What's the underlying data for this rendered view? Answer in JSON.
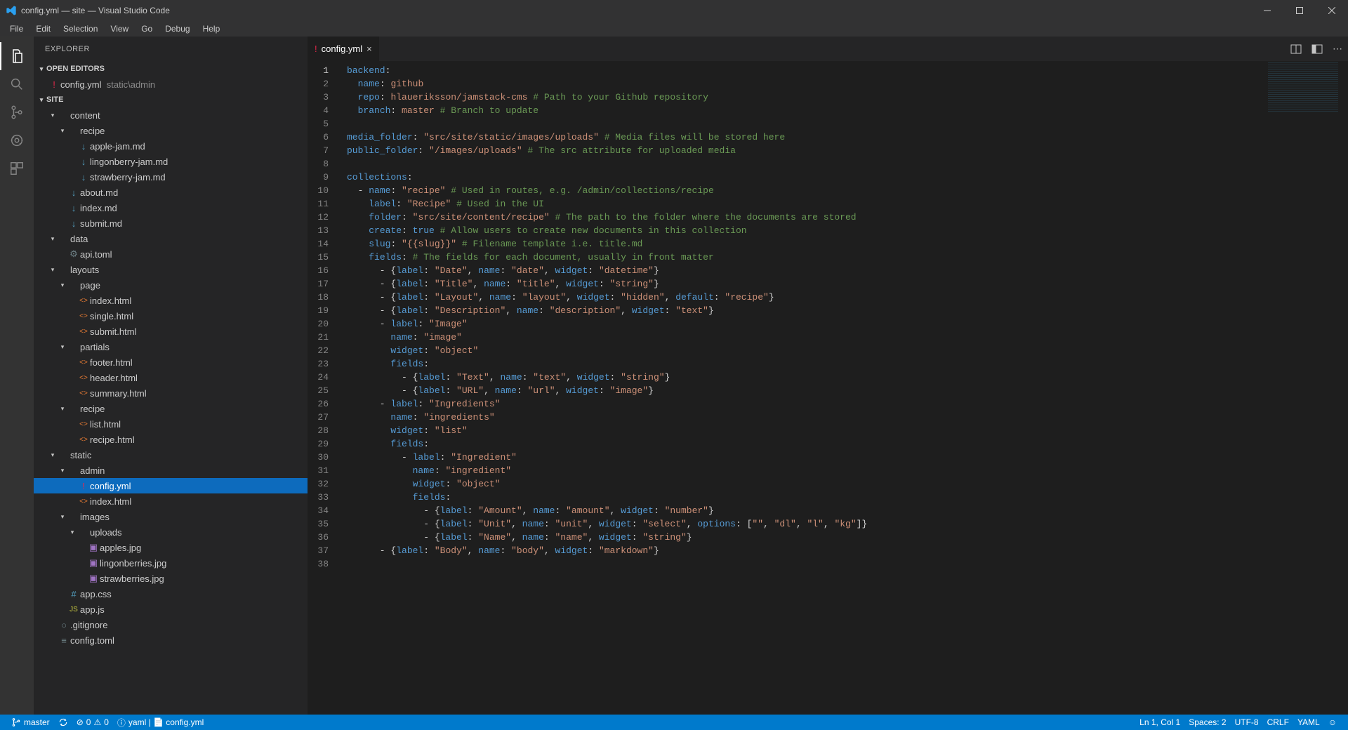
{
  "window": {
    "title": "config.yml — site — Visual Studio Code"
  },
  "menu": [
    "File",
    "Edit",
    "Selection",
    "View",
    "Go",
    "Debug",
    "Help"
  ],
  "sidebar": {
    "title": "EXPLORER",
    "open_editors": {
      "header": "OPEN EDITORS",
      "file": "config.yml",
      "path": "static\\admin"
    },
    "project": "SITE",
    "tree": [
      {
        "d": 1,
        "t": "folder",
        "open": true,
        "name": "content",
        "icon": ""
      },
      {
        "d": 2,
        "t": "folder",
        "open": true,
        "name": "recipe",
        "icon": ""
      },
      {
        "d": 3,
        "t": "file",
        "name": "apple-jam.md",
        "icon": "↓",
        "ic": "#519aba"
      },
      {
        "d": 3,
        "t": "file",
        "name": "lingonberry-jam.md",
        "icon": "↓",
        "ic": "#519aba"
      },
      {
        "d": 3,
        "t": "file",
        "name": "strawberry-jam.md",
        "icon": "↓",
        "ic": "#519aba"
      },
      {
        "d": 2,
        "t": "file",
        "name": "about.md",
        "icon": "↓",
        "ic": "#519aba"
      },
      {
        "d": 2,
        "t": "file",
        "name": "index.md",
        "icon": "↓",
        "ic": "#519aba"
      },
      {
        "d": 2,
        "t": "file",
        "name": "submit.md",
        "icon": "↓",
        "ic": "#519aba"
      },
      {
        "d": 1,
        "t": "folder",
        "open": true,
        "name": "data",
        "icon": ""
      },
      {
        "d": 2,
        "t": "file",
        "name": "api.toml",
        "icon": "⚙",
        "ic": "#6d8086"
      },
      {
        "d": 1,
        "t": "folder",
        "open": true,
        "name": "layouts",
        "icon": ""
      },
      {
        "d": 2,
        "t": "folder",
        "open": true,
        "name": "page",
        "icon": ""
      },
      {
        "d": 3,
        "t": "file",
        "name": "index.html",
        "icon": "<>",
        "ic": "#e37933"
      },
      {
        "d": 3,
        "t": "file",
        "name": "single.html",
        "icon": "<>",
        "ic": "#e37933"
      },
      {
        "d": 3,
        "t": "file",
        "name": "submit.html",
        "icon": "<>",
        "ic": "#e37933"
      },
      {
        "d": 2,
        "t": "folder",
        "open": true,
        "name": "partials",
        "icon": ""
      },
      {
        "d": 3,
        "t": "file",
        "name": "footer.html",
        "icon": "<>",
        "ic": "#e37933"
      },
      {
        "d": 3,
        "t": "file",
        "name": "header.html",
        "icon": "<>",
        "ic": "#e37933"
      },
      {
        "d": 3,
        "t": "file",
        "name": "summary.html",
        "icon": "<>",
        "ic": "#e37933"
      },
      {
        "d": 2,
        "t": "folder",
        "open": true,
        "name": "recipe",
        "icon": ""
      },
      {
        "d": 3,
        "t": "file",
        "name": "list.html",
        "icon": "<>",
        "ic": "#e37933"
      },
      {
        "d": 3,
        "t": "file",
        "name": "recipe.html",
        "icon": "<>",
        "ic": "#e37933"
      },
      {
        "d": 1,
        "t": "folder",
        "open": true,
        "name": "static",
        "icon": ""
      },
      {
        "d": 2,
        "t": "folder",
        "open": true,
        "name": "admin",
        "icon": ""
      },
      {
        "d": 3,
        "t": "file",
        "name": "config.yml",
        "icon": "!",
        "ic": "#e8274b",
        "selected": true
      },
      {
        "d": 3,
        "t": "file",
        "name": "index.html",
        "icon": "<>",
        "ic": "#e37933"
      },
      {
        "d": 2,
        "t": "folder",
        "open": true,
        "name": "images",
        "icon": ""
      },
      {
        "d": 3,
        "t": "folder",
        "open": true,
        "name": "uploads",
        "icon": ""
      },
      {
        "d": 4,
        "t": "file",
        "name": "apples.jpg",
        "icon": "▣",
        "ic": "#a074c4"
      },
      {
        "d": 4,
        "t": "file",
        "name": "lingonberries.jpg",
        "icon": "▣",
        "ic": "#a074c4"
      },
      {
        "d": 4,
        "t": "file",
        "name": "strawberries.jpg",
        "icon": "▣",
        "ic": "#a074c4"
      },
      {
        "d": 2,
        "t": "file",
        "name": "app.css",
        "icon": "#",
        "ic": "#519aba"
      },
      {
        "d": 2,
        "t": "file",
        "name": "app.js",
        "icon": "JS",
        "ic": "#cbcb41"
      },
      {
        "d": 1,
        "t": "file",
        "name": ".gitignore",
        "icon": "○",
        "ic": "#6d8086"
      },
      {
        "d": 1,
        "t": "file",
        "name": "config.toml",
        "icon": "≡",
        "ic": "#6d8086"
      }
    ]
  },
  "tab": {
    "name": "config.yml",
    "icon": "!"
  },
  "status": {
    "branch": "master",
    "errors": "0",
    "warnings": "0",
    "info_text": "yaml | 📄 config.yml",
    "ln_col": "Ln 1, Col 1",
    "spaces": "Spaces: 2",
    "encoding": "UTF-8",
    "eol": "CRLF",
    "lang": "YAML"
  },
  "code": [
    [
      [
        "k",
        "backend"
      ],
      [
        "p",
        ":"
      ]
    ],
    [
      [
        "p",
        "  "
      ],
      [
        "k",
        "name"
      ],
      [
        "p",
        ": "
      ],
      [
        "s",
        "github"
      ]
    ],
    [
      [
        "p",
        "  "
      ],
      [
        "k",
        "repo"
      ],
      [
        "p",
        ": "
      ],
      [
        "s",
        "hlaueriksson/jamstack-cms"
      ],
      [
        "p",
        " "
      ],
      [
        "c",
        "# Path to your Github repository"
      ]
    ],
    [
      [
        "p",
        "  "
      ],
      [
        "k",
        "branch"
      ],
      [
        "p",
        ": "
      ],
      [
        "s",
        "master"
      ],
      [
        "p",
        " "
      ],
      [
        "c",
        "# Branch to update"
      ]
    ],
    [
      [
        "p",
        ""
      ]
    ],
    [
      [
        "k",
        "media_folder"
      ],
      [
        "p",
        ": "
      ],
      [
        "s",
        "\"src/site/static/images/uploads\""
      ],
      [
        "p",
        " "
      ],
      [
        "c",
        "# Media files will be stored here"
      ]
    ],
    [
      [
        "k",
        "public_folder"
      ],
      [
        "p",
        ": "
      ],
      [
        "s",
        "\"/images/uploads\""
      ],
      [
        "p",
        " "
      ],
      [
        "c",
        "# The src attribute for uploaded media"
      ]
    ],
    [
      [
        "p",
        ""
      ]
    ],
    [
      [
        "k",
        "collections"
      ],
      [
        "p",
        ":"
      ]
    ],
    [
      [
        "p",
        "  - "
      ],
      [
        "k",
        "name"
      ],
      [
        "p",
        ": "
      ],
      [
        "s",
        "\"recipe\""
      ],
      [
        "p",
        " "
      ],
      [
        "c",
        "# Used in routes, e.g. /admin/collections/recipe"
      ]
    ],
    [
      [
        "p",
        "    "
      ],
      [
        "k",
        "label"
      ],
      [
        "p",
        ": "
      ],
      [
        "s",
        "\"Recipe\""
      ],
      [
        "p",
        " "
      ],
      [
        "c",
        "# Used in the UI"
      ]
    ],
    [
      [
        "p",
        "    "
      ],
      [
        "k",
        "folder"
      ],
      [
        "p",
        ": "
      ],
      [
        "s",
        "\"src/site/content/recipe\""
      ],
      [
        "p",
        " "
      ],
      [
        "c",
        "# The path to the folder where the documents are stored"
      ]
    ],
    [
      [
        "p",
        "    "
      ],
      [
        "k",
        "create"
      ],
      [
        "p",
        ": "
      ],
      [
        "b",
        "true"
      ],
      [
        "p",
        " "
      ],
      [
        "c",
        "# Allow users to create new documents in this collection"
      ]
    ],
    [
      [
        "p",
        "    "
      ],
      [
        "k",
        "slug"
      ],
      [
        "p",
        ": "
      ],
      [
        "s",
        "\"{{slug}}\""
      ],
      [
        "p",
        " "
      ],
      [
        "c",
        "# Filename template i.e. title.md"
      ]
    ],
    [
      [
        "p",
        "    "
      ],
      [
        "k",
        "fields"
      ],
      [
        "p",
        ": "
      ],
      [
        "c",
        "# The fields for each document, usually in front matter"
      ]
    ],
    [
      [
        "p",
        "      - {"
      ],
      [
        "k",
        "label"
      ],
      [
        "p",
        ": "
      ],
      [
        "s",
        "\"Date\""
      ],
      [
        "p",
        ", "
      ],
      [
        "k",
        "name"
      ],
      [
        "p",
        ": "
      ],
      [
        "s",
        "\"date\""
      ],
      [
        "p",
        ", "
      ],
      [
        "k",
        "widget"
      ],
      [
        "p",
        ": "
      ],
      [
        "s",
        "\"datetime\""
      ],
      [
        "p",
        "}"
      ]
    ],
    [
      [
        "p",
        "      - {"
      ],
      [
        "k",
        "label"
      ],
      [
        "p",
        ": "
      ],
      [
        "s",
        "\"Title\""
      ],
      [
        "p",
        ", "
      ],
      [
        "k",
        "name"
      ],
      [
        "p",
        ": "
      ],
      [
        "s",
        "\"title\""
      ],
      [
        "p",
        ", "
      ],
      [
        "k",
        "widget"
      ],
      [
        "p",
        ": "
      ],
      [
        "s",
        "\"string\""
      ],
      [
        "p",
        "}"
      ]
    ],
    [
      [
        "p",
        "      - {"
      ],
      [
        "k",
        "label"
      ],
      [
        "p",
        ": "
      ],
      [
        "s",
        "\"Layout\""
      ],
      [
        "p",
        ", "
      ],
      [
        "k",
        "name"
      ],
      [
        "p",
        ": "
      ],
      [
        "s",
        "\"layout\""
      ],
      [
        "p",
        ", "
      ],
      [
        "k",
        "widget"
      ],
      [
        "p",
        ": "
      ],
      [
        "s",
        "\"hidden\""
      ],
      [
        "p",
        ", "
      ],
      [
        "k",
        "default"
      ],
      [
        "p",
        ": "
      ],
      [
        "s",
        "\"recipe\""
      ],
      [
        "p",
        "}"
      ]
    ],
    [
      [
        "p",
        "      - {"
      ],
      [
        "k",
        "label"
      ],
      [
        "p",
        ": "
      ],
      [
        "s",
        "\"Description\""
      ],
      [
        "p",
        ", "
      ],
      [
        "k",
        "name"
      ],
      [
        "p",
        ": "
      ],
      [
        "s",
        "\"description\""
      ],
      [
        "p",
        ", "
      ],
      [
        "k",
        "widget"
      ],
      [
        "p",
        ": "
      ],
      [
        "s",
        "\"text\""
      ],
      [
        "p",
        "}"
      ]
    ],
    [
      [
        "p",
        "      - "
      ],
      [
        "k",
        "label"
      ],
      [
        "p",
        ": "
      ],
      [
        "s",
        "\"Image\""
      ]
    ],
    [
      [
        "p",
        "        "
      ],
      [
        "k",
        "name"
      ],
      [
        "p",
        ": "
      ],
      [
        "s",
        "\"image\""
      ]
    ],
    [
      [
        "p",
        "        "
      ],
      [
        "k",
        "widget"
      ],
      [
        "p",
        ": "
      ],
      [
        "s",
        "\"object\""
      ]
    ],
    [
      [
        "p",
        "        "
      ],
      [
        "k",
        "fields"
      ],
      [
        "p",
        ":"
      ]
    ],
    [
      [
        "p",
        "          - {"
      ],
      [
        "k",
        "label"
      ],
      [
        "p",
        ": "
      ],
      [
        "s",
        "\"Text\""
      ],
      [
        "p",
        ", "
      ],
      [
        "k",
        "name"
      ],
      [
        "p",
        ": "
      ],
      [
        "s",
        "\"text\""
      ],
      [
        "p",
        ", "
      ],
      [
        "k",
        "widget"
      ],
      [
        "p",
        ": "
      ],
      [
        "s",
        "\"string\""
      ],
      [
        "p",
        "}"
      ]
    ],
    [
      [
        "p",
        "          - {"
      ],
      [
        "k",
        "label"
      ],
      [
        "p",
        ": "
      ],
      [
        "s",
        "\"URL\""
      ],
      [
        "p",
        ", "
      ],
      [
        "k",
        "name"
      ],
      [
        "p",
        ": "
      ],
      [
        "s",
        "\"url\""
      ],
      [
        "p",
        ", "
      ],
      [
        "k",
        "widget"
      ],
      [
        "p",
        ": "
      ],
      [
        "s",
        "\"image\""
      ],
      [
        "p",
        "}"
      ]
    ],
    [
      [
        "p",
        "      - "
      ],
      [
        "k",
        "label"
      ],
      [
        "p",
        ": "
      ],
      [
        "s",
        "\"Ingredients\""
      ]
    ],
    [
      [
        "p",
        "        "
      ],
      [
        "k",
        "name"
      ],
      [
        "p",
        ": "
      ],
      [
        "s",
        "\"ingredients\""
      ]
    ],
    [
      [
        "p",
        "        "
      ],
      [
        "k",
        "widget"
      ],
      [
        "p",
        ": "
      ],
      [
        "s",
        "\"list\""
      ]
    ],
    [
      [
        "p",
        "        "
      ],
      [
        "k",
        "fields"
      ],
      [
        "p",
        ":"
      ]
    ],
    [
      [
        "p",
        "          - "
      ],
      [
        "k",
        "label"
      ],
      [
        "p",
        ": "
      ],
      [
        "s",
        "\"Ingredient\""
      ]
    ],
    [
      [
        "p",
        "            "
      ],
      [
        "k",
        "name"
      ],
      [
        "p",
        ": "
      ],
      [
        "s",
        "\"ingredient\""
      ]
    ],
    [
      [
        "p",
        "            "
      ],
      [
        "k",
        "widget"
      ],
      [
        "p",
        ": "
      ],
      [
        "s",
        "\"object\""
      ]
    ],
    [
      [
        "p",
        "            "
      ],
      [
        "k",
        "fields"
      ],
      [
        "p",
        ":"
      ]
    ],
    [
      [
        "p",
        "              - {"
      ],
      [
        "k",
        "label"
      ],
      [
        "p",
        ": "
      ],
      [
        "s",
        "\"Amount\""
      ],
      [
        "p",
        ", "
      ],
      [
        "k",
        "name"
      ],
      [
        "p",
        ": "
      ],
      [
        "s",
        "\"amount\""
      ],
      [
        "p",
        ", "
      ],
      [
        "k",
        "widget"
      ],
      [
        "p",
        ": "
      ],
      [
        "s",
        "\"number\""
      ],
      [
        "p",
        "}"
      ]
    ],
    [
      [
        "p",
        "              - {"
      ],
      [
        "k",
        "label"
      ],
      [
        "p",
        ": "
      ],
      [
        "s",
        "\"Unit\""
      ],
      [
        "p",
        ", "
      ],
      [
        "k",
        "name"
      ],
      [
        "p",
        ": "
      ],
      [
        "s",
        "\"unit\""
      ],
      [
        "p",
        ", "
      ],
      [
        "k",
        "widget"
      ],
      [
        "p",
        ": "
      ],
      [
        "s",
        "\"select\""
      ],
      [
        "p",
        ", "
      ],
      [
        "k",
        "options"
      ],
      [
        "p",
        ": ["
      ],
      [
        "s",
        "\"\""
      ],
      [
        "p",
        ", "
      ],
      [
        "s",
        "\"dl\""
      ],
      [
        "p",
        ", "
      ],
      [
        "s",
        "\"l\""
      ],
      [
        "p",
        ", "
      ],
      [
        "s",
        "\"kg\""
      ],
      [
        "p",
        "]}"
      ]
    ],
    [
      [
        "p",
        "              - {"
      ],
      [
        "k",
        "label"
      ],
      [
        "p",
        ": "
      ],
      [
        "s",
        "\"Name\""
      ],
      [
        "p",
        ", "
      ],
      [
        "k",
        "name"
      ],
      [
        "p",
        ": "
      ],
      [
        "s",
        "\"name\""
      ],
      [
        "p",
        ", "
      ],
      [
        "k",
        "widget"
      ],
      [
        "p",
        ": "
      ],
      [
        "s",
        "\"string\""
      ],
      [
        "p",
        "}"
      ]
    ],
    [
      [
        "p",
        "      - {"
      ],
      [
        "k",
        "label"
      ],
      [
        "p",
        ": "
      ],
      [
        "s",
        "\"Body\""
      ],
      [
        "p",
        ", "
      ],
      [
        "k",
        "name"
      ],
      [
        "p",
        ": "
      ],
      [
        "s",
        "\"body\""
      ],
      [
        "p",
        ", "
      ],
      [
        "k",
        "widget"
      ],
      [
        "p",
        ": "
      ],
      [
        "s",
        "\"markdown\""
      ],
      [
        "p",
        "}"
      ]
    ],
    [
      [
        "p",
        ""
      ]
    ]
  ]
}
